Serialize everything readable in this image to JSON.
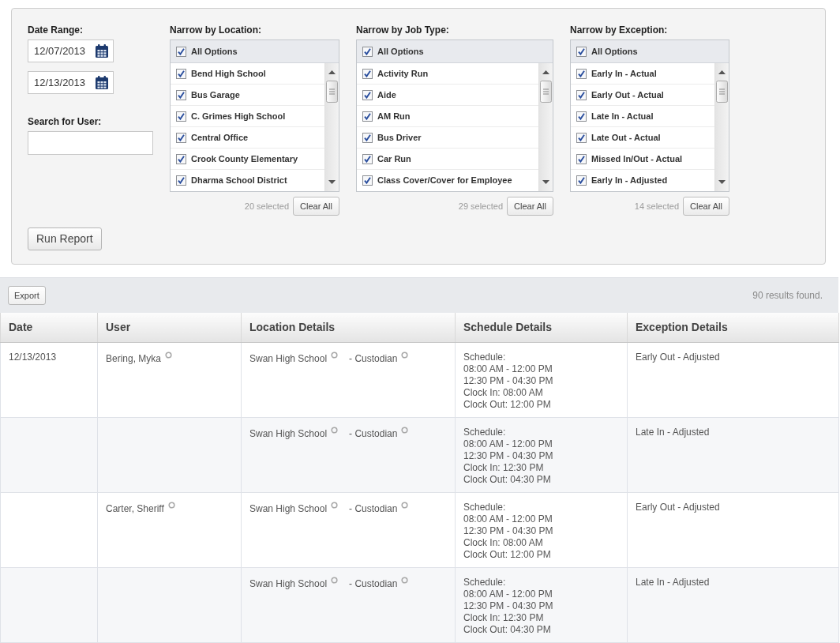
{
  "filters": {
    "date_range": {
      "label": "Date Range:",
      "start": "12/07/2013",
      "end": "12/13/2013"
    },
    "user_search": {
      "label": "Search for User:"
    },
    "lists": [
      {
        "label": "Narrow by Location:",
        "all_option": {
          "label": "All Options",
          "checked": true
        },
        "items": [
          {
            "label": "Bend High School",
            "checked": true
          },
          {
            "label": "Bus Garage",
            "checked": true
          },
          {
            "label": "C. Grimes High School",
            "checked": true
          },
          {
            "label": "Central Office",
            "checked": true
          },
          {
            "label": "Crook County Elementary",
            "checked": true
          },
          {
            "label": "Dharma School District",
            "checked": true
          }
        ],
        "selected_count": "20 selected",
        "clear_button": "Clear All"
      },
      {
        "label": "Narrow by Job Type:",
        "all_option": {
          "label": "All Options",
          "checked": true
        },
        "items": [
          {
            "label": "Activity Run",
            "checked": true
          },
          {
            "label": "Aide",
            "checked": true
          },
          {
            "label": "AM Run",
            "checked": true
          },
          {
            "label": "Bus Driver",
            "checked": true
          },
          {
            "label": "Car Run",
            "checked": true
          },
          {
            "label": "Class Cover/Cover for Employee",
            "checked": true
          }
        ],
        "selected_count": "29 selected",
        "clear_button": "Clear All"
      },
      {
        "label": "Narrow by Exception:",
        "all_option": {
          "label": "All Options",
          "checked": true
        },
        "items": [
          {
            "label": "Early In - Actual",
            "checked": true
          },
          {
            "label": "Early Out - Actual",
            "checked": true
          },
          {
            "label": "Late In - Actual",
            "checked": true
          },
          {
            "label": "Late Out - Actual",
            "checked": true
          },
          {
            "label": "Missed In/Out - Actual",
            "checked": true
          },
          {
            "label": "Early In - Adjusted",
            "checked": true
          }
        ],
        "selected_count": "14 selected",
        "clear_button": "Clear All"
      }
    ],
    "run_button": "Run Report"
  },
  "results": {
    "export_button": "Export",
    "count": "90 results found.",
    "table": {
      "columns": [
        "Date",
        "User",
        "Location Details",
        "Schedule Details",
        "Exception Details"
      ],
      "rows": [
        {
          "date": "12/13/2013",
          "user": "Bering, Myka",
          "location": "Swan High School",
          "job": "- Custodian",
          "schedule": [
            "Schedule:",
            "08:00 AM - 12:00 PM",
            "12:30 PM - 04:30 PM",
            "Clock In: 08:00 AM",
            "Clock Out: 12:00 PM"
          ],
          "exception": "Early Out - Adjusted"
        },
        {
          "location": "Swan High School",
          "job": "- Custodian",
          "schedule": [
            "Schedule:",
            "08:00 AM - 12:00 PM",
            "12:30 PM - 04:30 PM",
            "Clock In: 12:30 PM",
            "Clock Out: 04:30 PM"
          ],
          "exception": "Late In - Adjusted"
        },
        {
          "user": "Carter, Sheriff",
          "location": "Swan High School",
          "job": "- Custodian",
          "schedule": [
            "Schedule:",
            "08:00 AM - 12:00 PM",
            "12:30 PM - 04:30 PM",
            "Clock In: 08:00 AM",
            "Clock Out: 12:00 PM"
          ],
          "exception": "Early Out - Adjusted"
        },
        {
          "location": "Swan High School",
          "job": "- Custodian",
          "schedule": [
            "Schedule:",
            "08:00 AM - 12:00 PM",
            "12:30 PM - 04:30 PM",
            "Clock In: 12:30 PM",
            "Clock Out: 04:30 PM"
          ],
          "exception": "Late In - Adjusted"
        }
      ]
    }
  }
}
